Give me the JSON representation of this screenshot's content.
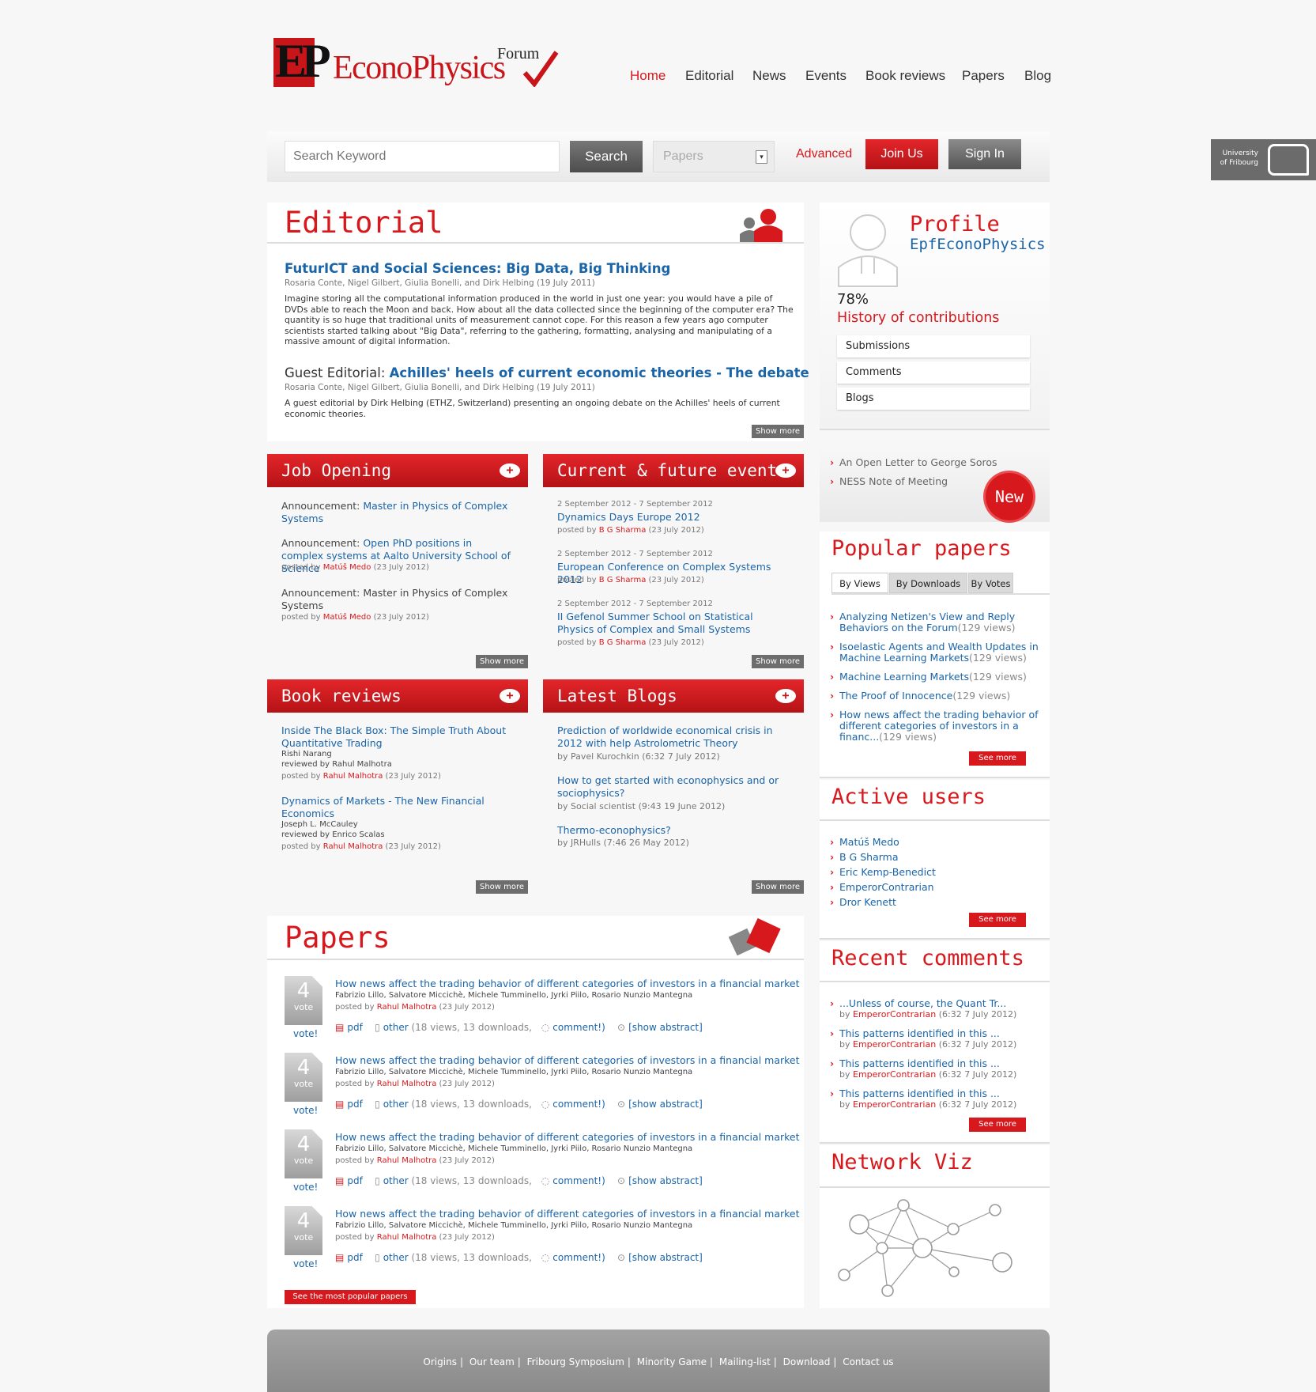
{
  "brand": {
    "ep": "EP",
    "name": "EconoPhysics",
    "forum": "Forum"
  },
  "nav": [
    "Home",
    "Editorial",
    "News",
    "Events",
    "Book reviews",
    "Papers",
    "Blog"
  ],
  "search": {
    "placeholder": "Search Keyword",
    "button": "Search",
    "category": "Papers",
    "advanced": "Advanced",
    "join": "Join Us",
    "signin": "Sign In"
  },
  "unifr": {
    "line1": "University",
    "line2": "of Fribourg"
  },
  "editorial": {
    "title": "Editorial",
    "items": [
      {
        "title": "FuturICT and Social Sciences: Big Data, Big Thinking",
        "authors": "Rosaria Conte, Nigel Gilbert, Giulia Bonelli, and Dirk Helbing (19 July 2011)",
        "text": "Imagine storing all the computational information produced in the world in just one year: you would have a pile of DVDs able to reach the Moon and back. How about all the data collected since the beginning of the computer era? The quantity is so huge that traditional units of measurement cannot cope. For this reason a few years ago computer scientists started talking about \"Big Data\", referring to the gathering, formatting, analysing and manipulating of a massive amount of digital information."
      },
      {
        "prefix": "Guest Editorial: ",
        "title": "Achilles' heels of current economic theories - The debate",
        "authors": "Rosaria Conte, Nigel Gilbert, Giulia Bonelli, and Dirk Helbing (19 July 2011)",
        "text": "A guest editorial by Dirk Helbing (ETHZ, Switzerland) presenting an ongoing debate on the Achilles' heels of current economic theories."
      }
    ],
    "show_more": "Show more"
  },
  "jobs": {
    "title": "Job Opening",
    "show_more": "Show more",
    "items": [
      {
        "prefix": "Announcement: ",
        "title": "Master in Physics of Complex Systems",
        "posted": "",
        "by": "",
        "date": ""
      },
      {
        "prefix": "Announcement: ",
        "title": "Open PhD positions in complex systems at Aalto University School of Science",
        "posted": "posted by ",
        "by": "Matúš Medo",
        "date": " (23 July 2012)"
      },
      {
        "prefix": "Announcement: ",
        "title": "Master in Physics of Complex Systems",
        "plain": true,
        "posted": "posted by ",
        "by": "Matúš Medo",
        "date": " (23 July 2012)"
      }
    ]
  },
  "events": {
    "title": "Current & future events",
    "show_more": "Show more",
    "items": [
      {
        "when": "2 September 2012 - 7 September 2012",
        "title": "Dynamics Days Europe 2012",
        "posted": "posted by ",
        "by": "B G Sharma",
        "date": " (23 July 2012)"
      },
      {
        "when": "2 September 2012 - 7 September 2012",
        "title": "European Conference on Complex Systems 2012",
        "posted": "posted by ",
        "by": "B G Sharma",
        "date": " (23 July 2012)"
      },
      {
        "when": "2 September 2012 - 7 September 2012",
        "title": "II Gefenol Summer School on Statistical Physics of Complex and Small Systems",
        "posted": "posted by ",
        "by": "B G Sharma",
        "date": " (23 July 2012)"
      }
    ]
  },
  "books": {
    "title": "Book reviews",
    "show_more": "Show more",
    "items": [
      {
        "title": "Inside The Black Box: The Simple Truth About Quantitative Trading",
        "author": "Rishi Narang",
        "reviewed": "reviewed by Rahul Malhotra",
        "posted": "posted by ",
        "by": "Rahul Malhotra",
        "date": " (23 July 2012)"
      },
      {
        "title": "Dynamics of Markets - The New Financial Economics",
        "author": "Joseph L. McCauley",
        "reviewed": "reviewed by Enrico Scalas",
        "posted": "posted by ",
        "by": "Rahul Malhotra",
        "date": " (23 July 2012)"
      }
    ]
  },
  "blogs": {
    "title": "Latest Blogs",
    "show_more": "Show more",
    "items": [
      {
        "title": "Prediction of worldwide economical crisis in 2012 with help Astrolometric Theory",
        "meta": "by Pavel Kurochkin (6:32 7 July 2012)"
      },
      {
        "title": "How to get started with econophysics and or sociophysics?",
        "meta": "by Social scientist (9:43 19 June 2012)"
      },
      {
        "title": "Thermo-econophysics?",
        "meta": "by JRHulls (7:46 26 May 2012)"
      }
    ]
  },
  "papers": {
    "title": "Papers",
    "see_popular": "See the most popular papers",
    "items": [
      {
        "votes": "4",
        "vote_label": "vote",
        "vote_link": "vote!",
        "title": "How news affect the trading behavior of different categories of investors in a financial market",
        "authors": "Fabrizio Lillo, Salvatore Miccichè, Michele Tumminello, Jyrki Piilo, Rosario Nunzio Mantegna",
        "posted": "posted by ",
        "by": "Rahul Malhotra",
        "date": " (23 July 2012)",
        "pdf": "pdf",
        "other": "other",
        "stats": "(18 views, 13 downloads,",
        "comment": "comment!)",
        "abstract": "[show abstract]"
      },
      {
        "votes": "4",
        "vote_label": "vote",
        "vote_link": "vote!",
        "title": "How news affect the trading behavior of different categories of investors in a financial market",
        "authors": "Fabrizio Lillo, Salvatore Miccichè, Michele Tumminello, Jyrki Piilo, Rosario Nunzio Mantegna",
        "posted": "posted by ",
        "by": "Rahul Malhotra",
        "date": " (23 July 2012)",
        "pdf": "pdf",
        "other": "other",
        "stats": "(18 views, 13 downloads,",
        "comment": "comment!)",
        "abstract": "[show abstract]"
      },
      {
        "votes": "4",
        "vote_label": "vote",
        "vote_link": "vote!",
        "title": "How news affect the trading behavior of different categories of investors in a financial market",
        "authors": "Fabrizio Lillo, Salvatore Miccichè, Michele Tumminello, Jyrki Piilo, Rosario Nunzio Mantegna",
        "posted": "posted by ",
        "by": "Rahul Malhotra",
        "date": " (23 July 2012)",
        "pdf": "pdf",
        "other": "other",
        "stats": "(18 views, 13 downloads,",
        "comment": "comment!)",
        "abstract": "[show abstract]"
      },
      {
        "votes": "4",
        "vote_label": "vote",
        "vote_link": "vote!",
        "title": "How news affect the trading behavior of different categories of investors in a financial market",
        "authors": "Fabrizio Lillo, Salvatore Miccichè, Michele Tumminello, Jyrki Piilo, Rosario Nunzio Mantegna",
        "posted": "posted by ",
        "by": "Rahul Malhotra",
        "date": " (23 July 2012)",
        "pdf": "pdf",
        "other": "other",
        "stats": "(18 views, 13 downloads,",
        "comment": "comment!)",
        "abstract": "[show abstract]"
      }
    ]
  },
  "profile": {
    "title": "Profile",
    "user": "EpfEconoPhysics",
    "percent": "78%",
    "history": "History of contributions",
    "links": [
      "Submissions",
      "Comments",
      "Blogs"
    ]
  },
  "news": {
    "items": [
      "An Open Letter to George Soros",
      "NESS Note of Meeting"
    ],
    "badge": "New"
  },
  "popular": {
    "title": "Popular papers",
    "tabs": [
      "By Views",
      "By Downloads",
      "By Votes"
    ],
    "see_more": "See more",
    "items": [
      {
        "title": "Analyzing Netizen's View and Reply Behaviors on the Forum",
        "views": "(129 views)"
      },
      {
        "title": "Isoelastic Agents and Wealth Updates in Machine Learning Markets",
        "views": "(129 views)"
      },
      {
        "title": "Machine Learning Markets",
        "views": "(129 views)"
      },
      {
        "title": "The Proof of Innocence",
        "views": "(129 views)"
      },
      {
        "title": "How news affect the trading behavior of different categories of investors in a financ...",
        "views": "(129 views)"
      }
    ]
  },
  "active": {
    "title": "Active users",
    "users": [
      "Matúš Medo",
      "B G Sharma",
      "Eric Kemp-Benedict",
      "EmperorContrarian",
      "Dror Kenett"
    ],
    "see_more": "See more"
  },
  "comments": {
    "title": "Recent comments",
    "see_more": "See more",
    "items": [
      {
        "text": "...Unless of course, the Quant Tr...",
        "by": "EmperorContrarian",
        "date": " (6:32 7 July 2012)"
      },
      {
        "text": "This patterns identified in this ...",
        "by": "EmperorContrarian",
        "date": " (6:32 7 July 2012)"
      },
      {
        "text": "This patterns identified in this ...",
        "by": "EmperorContrarian",
        "date": " (6:32 7 July 2012)"
      },
      {
        "text": "This patterns identified in this ...",
        "by": "EmperorContrarian",
        "date": " (6:32 7 July 2012)"
      }
    ]
  },
  "network": {
    "title": "Network Viz"
  },
  "footer": [
    "Origins",
    "Our team",
    "Fribourg Symposium",
    "Minority Game",
    "Mailing-list",
    "Download",
    "Contact us"
  ],
  "colors": {
    "accent": "#d7191d",
    "link": "#1a64a8"
  }
}
